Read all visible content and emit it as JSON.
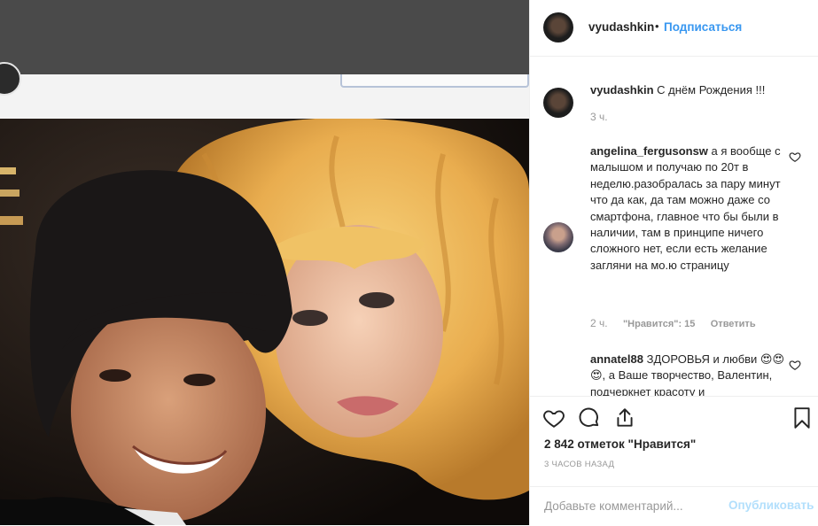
{
  "post": {
    "author": "vyudashkin",
    "separator": "•",
    "follow_label": "Подписаться"
  },
  "comments": [
    {
      "user": "vyudashkin",
      "text": "С днём Рождения !!!",
      "time": "3 ч."
    },
    {
      "user": "angelina_fergusonsw",
      "text": "а я вообще с малышом и получаю по 20т в неделю.разобралась за пару минут что да как, да там можно даже со смартфона, главное что бы были в наличии, там в принципе ничего сложного нет, если есть желание загляни на мо.ю страницу",
      "time": "2 ч.",
      "likes": "\"Нравится\": 15",
      "reply_label": "Ответить"
    },
    {
      "user": "annatel88",
      "text": "ЗДОРОВЬЯ и любви 😍😍😍, а Ваше творчество, Валентин, подчеркнет красоту и"
    }
  ],
  "stats": {
    "likes_text": "2 842 отметок \"Нравится\"",
    "time_ago": "3 часов назад"
  },
  "add_comment": {
    "placeholder": "Добавьте комментарий...",
    "publish_label": "Опубликовать"
  },
  "icons": {
    "like": "heart-outline-icon",
    "comment": "speech-bubble-icon",
    "share": "share-icon",
    "save": "bookmark-icon"
  },
  "colors": {
    "link_blue": "#3897f0",
    "publish_disabled": "#b2dffc",
    "meta_gray": "#999999"
  }
}
